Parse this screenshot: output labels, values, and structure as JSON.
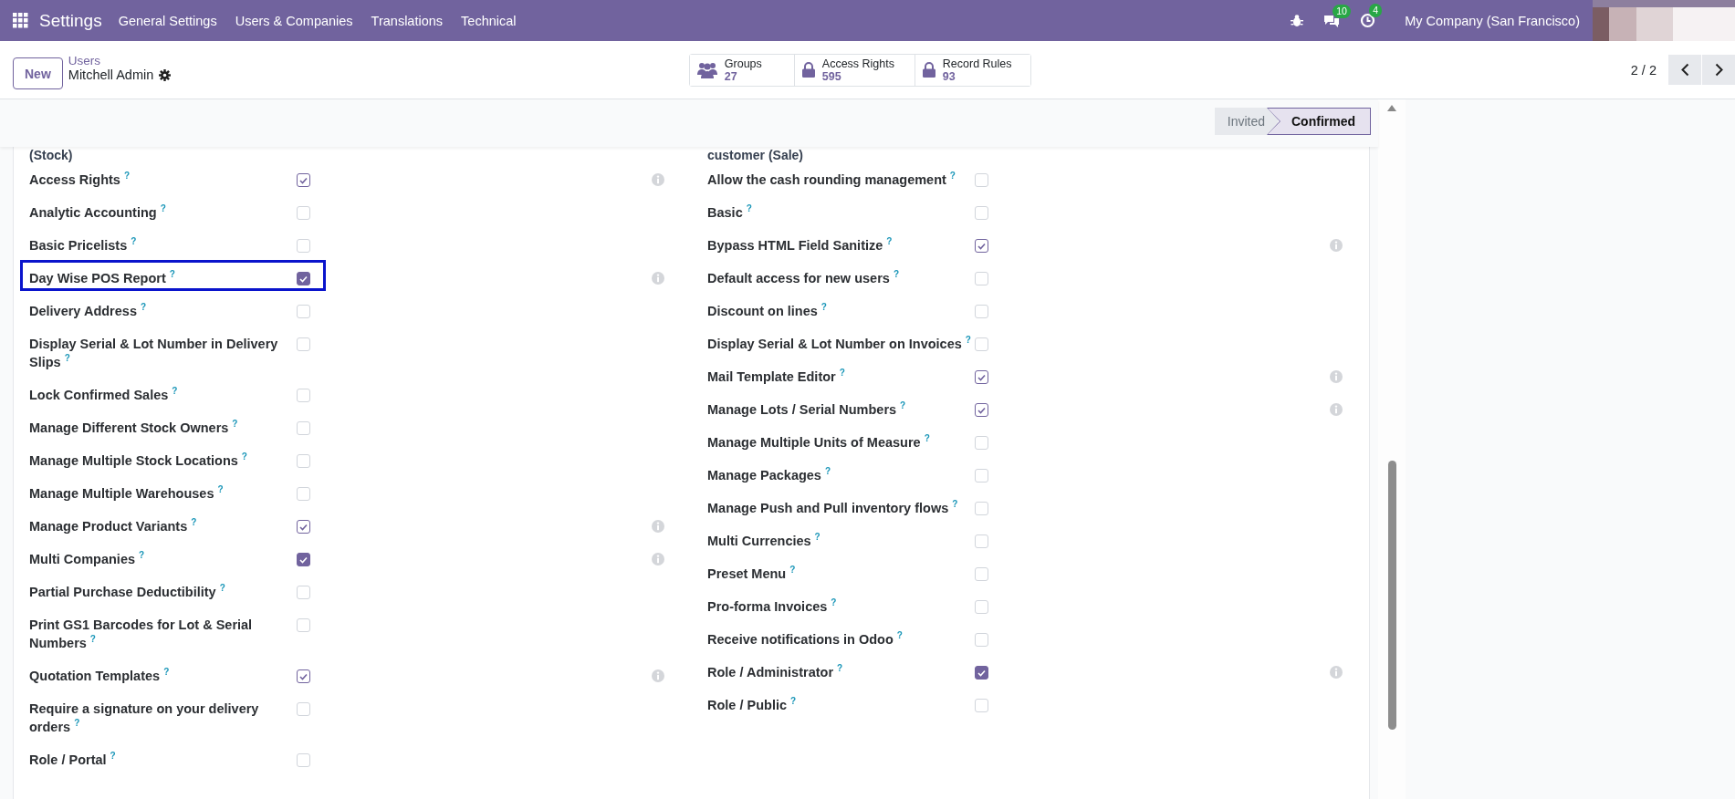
{
  "navbar": {
    "app_title": "Settings",
    "menu": [
      "General Settings",
      "Users & Companies",
      "Translations",
      "Technical"
    ],
    "chat_badge": "10",
    "activity_badge": "4",
    "company": "My Company (San Francisco)"
  },
  "control_panel": {
    "new_button": "New",
    "breadcrumb": {
      "parent": "Users",
      "current": "Mitchell Admin"
    },
    "stat_buttons": [
      {
        "kind": "users",
        "label": "Groups",
        "value": "27"
      },
      {
        "kind": "lock",
        "label": "Access Rights",
        "value": "595"
      },
      {
        "kind": "lock",
        "label": "Record Rules",
        "value": "93"
      }
    ],
    "pager": "2 / 2"
  },
  "status_stages": [
    {
      "label": "Invited",
      "selected": false
    },
    {
      "label": "Confirmed",
      "selected": true
    }
  ],
  "columns": [
    {
      "cut_line": "(Stock)",
      "rows": [
        {
          "label": "Access Rights",
          "help": "?",
          "checked": true,
          "kind": "outline",
          "info": true,
          "highlighted": false
        },
        {
          "label": "Analytic Accounting",
          "help": "?",
          "checked": false,
          "kind": "outline",
          "info": false,
          "highlighted": false
        },
        {
          "label": "Basic Pricelists",
          "help": "?",
          "checked": false,
          "kind": "outline",
          "info": false,
          "highlighted": false
        },
        {
          "label": "Day Wise POS Report",
          "help": "?",
          "checked": true,
          "kind": "solid",
          "info": true,
          "highlighted": true
        },
        {
          "label": "Delivery Address",
          "help": "?",
          "checked": false,
          "kind": "outline",
          "info": false,
          "highlighted": false
        },
        {
          "label": "Display Serial & Lot Number in Delivery Slips",
          "help": "?",
          "checked": false,
          "kind": "outline",
          "info": false,
          "highlighted": false
        },
        {
          "label": "Lock Confirmed Sales",
          "help": "?",
          "checked": false,
          "kind": "outline",
          "info": false,
          "highlighted": false
        },
        {
          "label": "Manage Different Stock Owners",
          "help": "?",
          "checked": false,
          "kind": "outline",
          "info": false,
          "highlighted": false
        },
        {
          "label": "Manage Multiple Stock Locations",
          "help": "?",
          "checked": false,
          "kind": "outline",
          "info": false,
          "highlighted": false
        },
        {
          "label": "Manage Multiple Warehouses",
          "help": "?",
          "checked": false,
          "kind": "outline",
          "info": false,
          "highlighted": false
        },
        {
          "label": "Manage Product Variants",
          "help": "?",
          "checked": true,
          "kind": "outline",
          "info": true,
          "highlighted": false
        },
        {
          "label": "Multi Companies",
          "help": "?",
          "checked": true,
          "kind": "solid",
          "info": true,
          "highlighted": false
        },
        {
          "label": "Partial Purchase Deductibility",
          "help": "?",
          "checked": false,
          "kind": "outline",
          "info": false,
          "highlighted": false
        },
        {
          "label": "Print GS1 Barcodes for Lot & Serial Numbers",
          "help": "?",
          "checked": false,
          "kind": "outline",
          "info": false,
          "highlighted": false
        },
        {
          "label": "Quotation Templates",
          "help": "?",
          "checked": true,
          "kind": "outline",
          "info": true,
          "highlighted": false
        },
        {
          "label": "Require a signature on your delivery orders",
          "help": "?",
          "checked": false,
          "kind": "outline",
          "info": false,
          "highlighted": false
        },
        {
          "label": "Role / Portal",
          "help": "?",
          "checked": false,
          "kind": "outline",
          "info": false,
          "highlighted": false
        }
      ]
    },
    {
      "cut_line": "customer (Sale)",
      "rows": [
        {
          "label": "Allow the cash rounding management",
          "help": "?",
          "checked": false,
          "kind": "outline",
          "info": false,
          "highlighted": false
        },
        {
          "label": "Basic",
          "help": "?",
          "checked": false,
          "kind": "outline",
          "info": false,
          "highlighted": false
        },
        {
          "label": "Bypass HTML Field Sanitize",
          "help": "?",
          "checked": true,
          "kind": "outline",
          "info": true,
          "highlighted": false
        },
        {
          "label": "Default access for new users",
          "help": "?",
          "checked": false,
          "kind": "outline",
          "info": false,
          "highlighted": false
        },
        {
          "label": "Discount on lines",
          "help": "?",
          "checked": false,
          "kind": "outline",
          "info": false,
          "highlighted": false
        },
        {
          "label": "Display Serial & Lot Number on Invoices",
          "help": "?",
          "checked": false,
          "kind": "outline",
          "info": false,
          "highlighted": false
        },
        {
          "label": "Mail Template Editor",
          "help": "?",
          "checked": true,
          "kind": "outline",
          "info": true,
          "highlighted": false
        },
        {
          "label": "Manage Lots / Serial Numbers",
          "help": "?",
          "checked": true,
          "kind": "outline",
          "info": true,
          "highlighted": false
        },
        {
          "label": "Manage Multiple Units of Measure",
          "help": "?",
          "checked": false,
          "kind": "outline",
          "info": false,
          "highlighted": false
        },
        {
          "label": "Manage Packages",
          "help": "?",
          "checked": false,
          "kind": "outline",
          "info": false,
          "highlighted": false
        },
        {
          "label": "Manage Push and Pull inventory flows",
          "help": "?",
          "checked": false,
          "kind": "outline",
          "info": false,
          "highlighted": false
        },
        {
          "label": "Multi Currencies",
          "help": "?",
          "checked": false,
          "kind": "outline",
          "info": false,
          "highlighted": false
        },
        {
          "label": "Preset Menu",
          "help": "?",
          "checked": false,
          "kind": "outline",
          "info": false,
          "highlighted": false
        },
        {
          "label": "Pro-forma Invoices",
          "help": "?",
          "checked": false,
          "kind": "outline",
          "info": false,
          "highlighted": false
        },
        {
          "label": "Receive notifications in Odoo",
          "help": "?",
          "checked": false,
          "kind": "outline",
          "info": false,
          "highlighted": false
        },
        {
          "label": "Role / Administrator",
          "help": "?",
          "checked": true,
          "kind": "solid",
          "info": true,
          "highlighted": false
        },
        {
          "label": "Role / Public",
          "help": "?",
          "checked": false,
          "kind": "outline",
          "info": false,
          "highlighted": false
        }
      ]
    }
  ]
}
